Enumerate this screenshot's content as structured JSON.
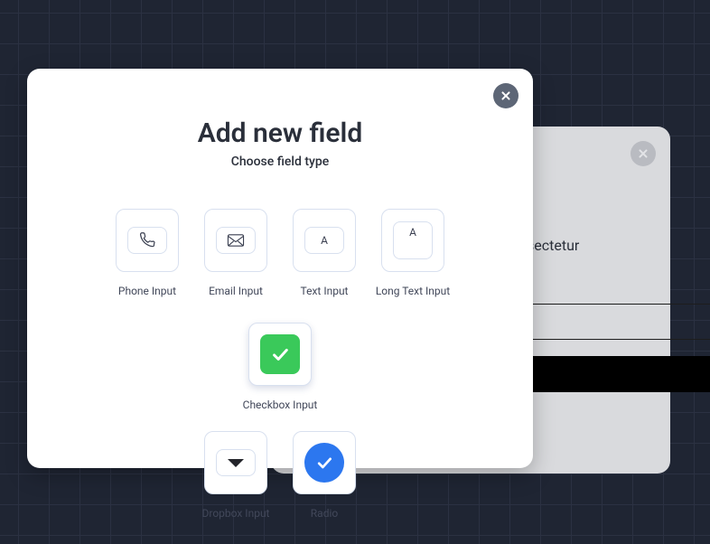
{
  "modal": {
    "title": "Add new field",
    "subtitle": "Choose field type",
    "tiles": [
      {
        "label": "Phone Input"
      },
      {
        "label": "Email Input"
      },
      {
        "label": "Text Input",
        "letter": "A"
      },
      {
        "label": "Long Text Input",
        "letter": "A"
      },
      {
        "label": "Checkbox Input"
      },
      {
        "label": "Dropbox Input"
      },
      {
        "label": "Radio"
      }
    ]
  },
  "background": {
    "visible_text": "sectetur"
  }
}
